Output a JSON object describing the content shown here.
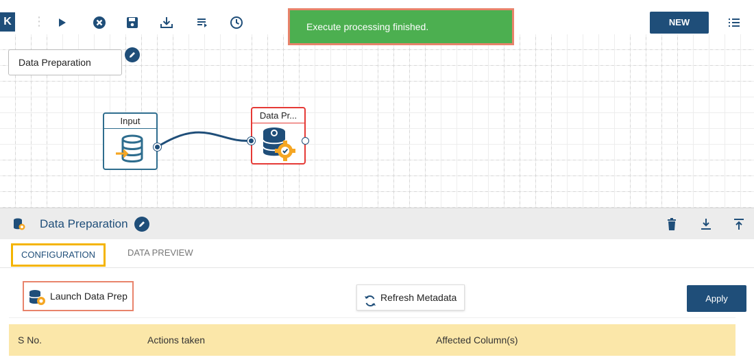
{
  "toolbar": {
    "back_label": "K",
    "toast": "Execute processing finished.",
    "new_label": "NEW",
    "icons": [
      "run-icon",
      "stop-icon",
      "save-icon",
      "download-icon",
      "logs-icon",
      "history-icon",
      "menu-icon"
    ]
  },
  "canvas": {
    "pipeline_name": "Data Preparation",
    "nodes": [
      {
        "title": "Input"
      },
      {
        "title": "Data Pr..."
      }
    ]
  },
  "panel": {
    "title": "Data Preparation",
    "tabs": [
      "CONFIGURATION",
      "DATA PREVIEW"
    ],
    "launch_label": "Launch Data Prep",
    "refresh_label": "Refresh Metadata",
    "apply_label": "Apply",
    "table_headers": [
      "S No.",
      "Actions taken",
      "Affected Column(s)"
    ]
  },
  "colors": {
    "primary": "#1f4e79",
    "toast_bg": "#4caf50",
    "highlight": "#e8836b",
    "tab_highlight": "#f4b400",
    "table_header_bg": "#fbe7a9",
    "node_error": "#e53935"
  }
}
